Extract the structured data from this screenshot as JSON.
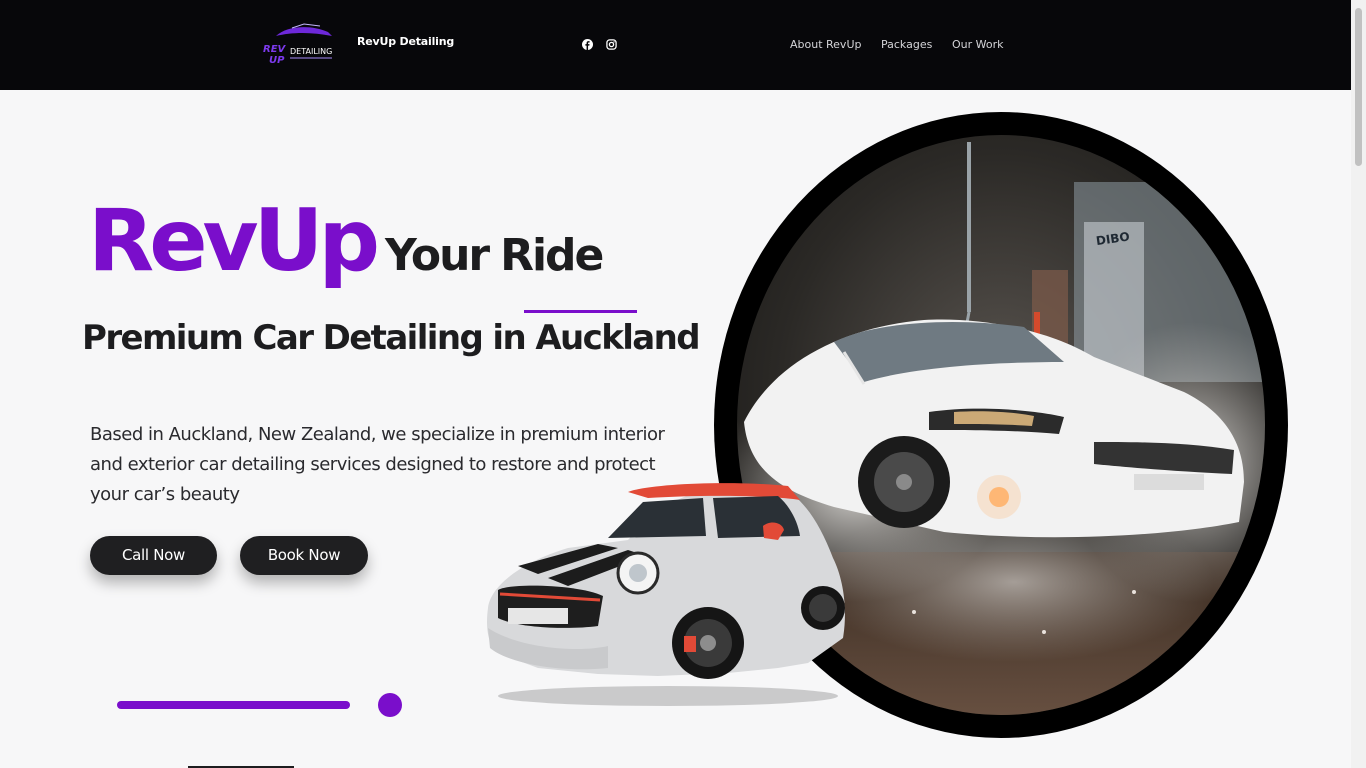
{
  "header": {
    "brand_name": "RevUp Detailing",
    "logo_text_rev": "REV",
    "logo_text_up": "UP",
    "logo_text_detailing": "DETAILING",
    "social": [
      "facebook-icon",
      "instagram-icon"
    ],
    "nav": [
      {
        "label": "About RevUp"
      },
      {
        "label": "Packages"
      },
      {
        "label": "Our Work"
      }
    ]
  },
  "hero": {
    "title_brand": "RevUp",
    "title_your": "Your",
    "title_ride": "Ride",
    "subtitle": "Premium Car Detailing in Auckland",
    "description": "Based in Auckland, New Zealand, we specialize in premium interior and exterior car detailing services designed to restore and protect your car’s beauty",
    "call_button": "Call Now",
    "book_button": "Book Now",
    "photo_sign": "DIBO"
  },
  "colors": {
    "accent": "#7a0ecb",
    "header_bg": "#07070a",
    "page_bg": "#f7f7f8",
    "button_bg": "#1f1f21"
  }
}
